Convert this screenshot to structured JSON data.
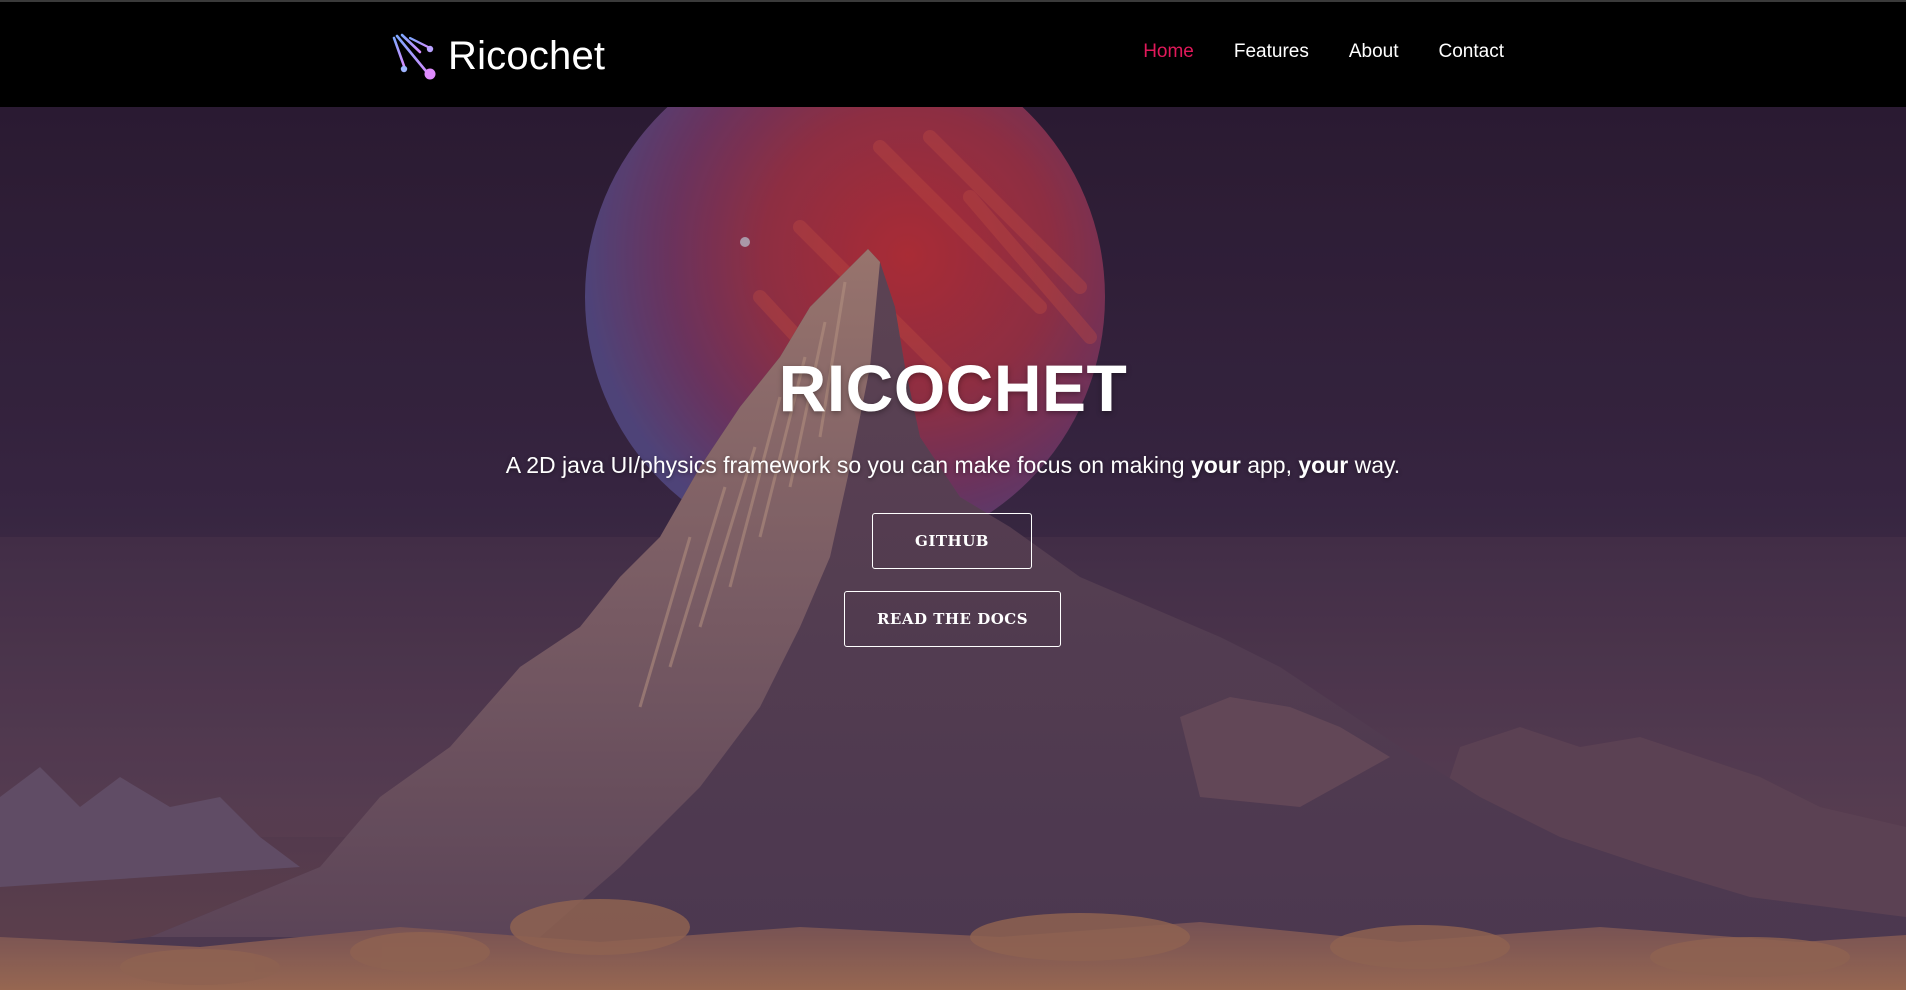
{
  "nav": {
    "brand_name": "Ricochet",
    "brand_icon": "ricochet-logo-icon",
    "links": [
      {
        "label": "Home",
        "active": true
      },
      {
        "label": "Features",
        "active": false
      },
      {
        "label": "About",
        "active": false
      },
      {
        "label": "Contact",
        "active": false
      }
    ],
    "active_color": "#e0195a"
  },
  "hero": {
    "title": "RICOCHET",
    "subtitle_parts": [
      "A 2D java UI/physics framework so you can make focus on making ",
      "your",
      " app, ",
      "your",
      " way."
    ],
    "buttons": {
      "github_label": "GITHUB",
      "docs_label": "READ THE DOCS"
    },
    "background_image": "desert-mountain-planet-illustration"
  }
}
